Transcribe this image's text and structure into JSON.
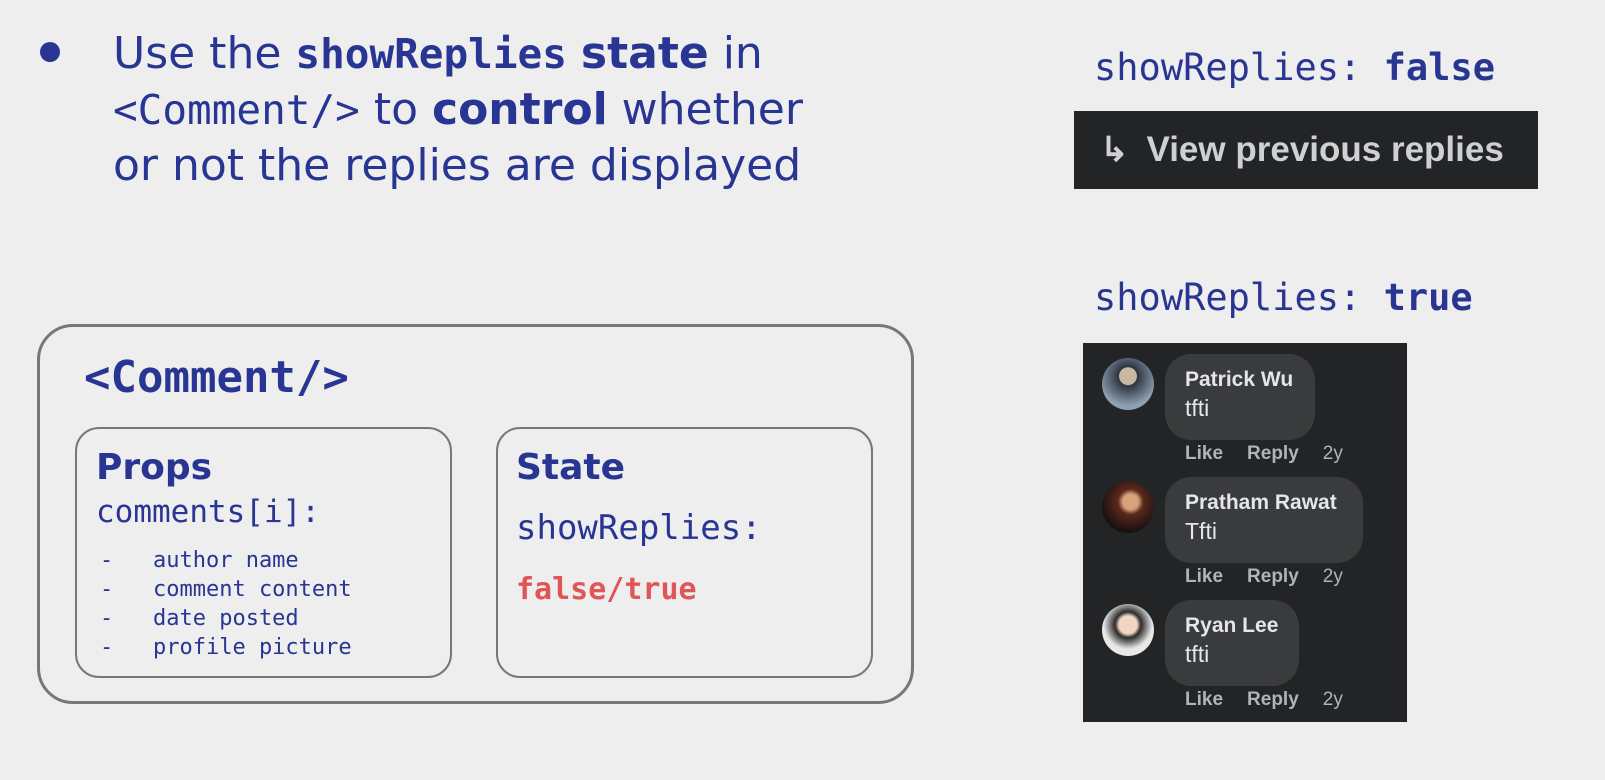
{
  "bullet": {
    "t1": "Use the ",
    "t2": "showReplies",
    "t3": " ",
    "t4": "state",
    "t5": " in ",
    "t6": "<Comment/>",
    "t7": " to ",
    "t8": "control",
    "t9": " whether or not the replies are displayed"
  },
  "component": {
    "title": "<Comment/>",
    "props": {
      "title": "Props",
      "label": "comments[i]:",
      "items": [
        "-   author name",
        "-   comment content",
        "-   date posted",
        "-   profile picture"
      ]
    },
    "state": {
      "title": "State",
      "label": "showReplies:",
      "value": "false/true"
    }
  },
  "examples": {
    "false_key": "showReplies: ",
    "false_val": "false",
    "true_key": "showReplies: ",
    "true_val": "true",
    "view_prev_icon": "reply-arrow-icon",
    "view_prev_label": "View previous replies"
  },
  "comments": [
    {
      "author": "Patrick Wu",
      "text": "tfti",
      "like": "Like",
      "reply": "Reply",
      "age": "2y"
    },
    {
      "author": "Pratham Rawat",
      "text": "Tfti",
      "like": "Like",
      "reply": "Reply",
      "age": "2y"
    },
    {
      "author": "Ryan Lee",
      "text": "tfti",
      "like": "Like",
      "reply": "Reply",
      "age": "2y"
    }
  ]
}
